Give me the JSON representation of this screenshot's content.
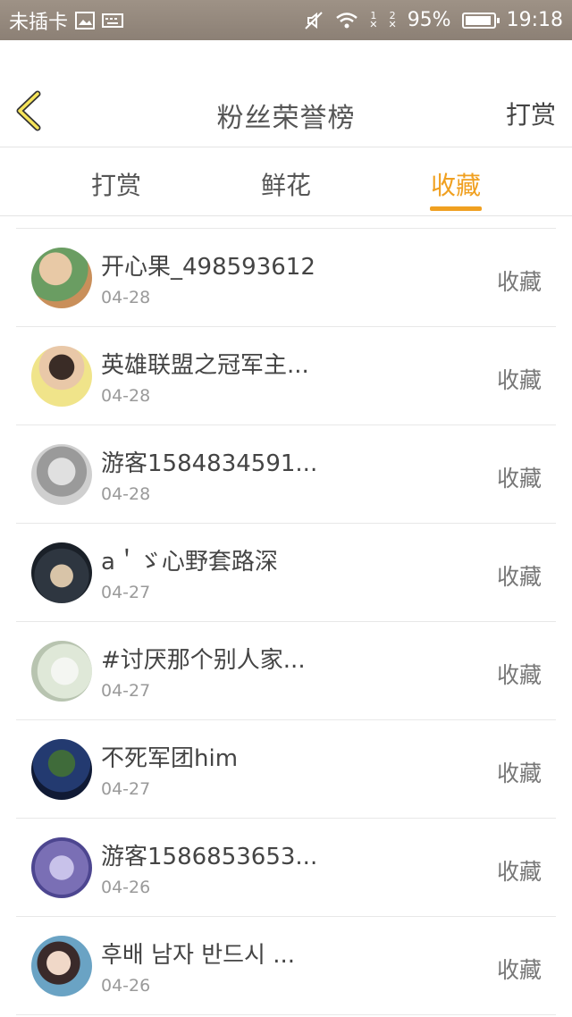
{
  "status_bar": {
    "carrier": "未插卡",
    "battery": "95%",
    "time": "19:18",
    "sim1": "1",
    "sim2": "2",
    "icons": [
      "image-icon",
      "keyboard-icon",
      "mute-icon",
      "wifi-icon",
      "signal1-icon",
      "signal2-icon",
      "battery-icon"
    ]
  },
  "header": {
    "title": "粉丝荣誉榜",
    "right_action": "打赏",
    "back_icon": "chevron-left-icon",
    "accent": "#f0a020"
  },
  "tabs": [
    {
      "label": "打赏",
      "active": false
    },
    {
      "label": "鲜花",
      "active": false
    },
    {
      "label": "收藏",
      "active": true
    }
  ],
  "list": [
    {
      "name": "开心果_498593612",
      "date": "04-28",
      "type": "收藏",
      "avatar_color": "#6a9d62"
    },
    {
      "name": "英雄联盟之冠军主...",
      "date": "04-28",
      "type": "收藏",
      "avatar_color": "#f0e48a"
    },
    {
      "name": "游客1584834591...",
      "date": "04-28",
      "type": "收藏",
      "avatar_color": "#b8b8b8"
    },
    {
      "name": "a＇ゞ心野套路深",
      "date": "04-27",
      "type": "收藏",
      "avatar_color": "#2e3640"
    },
    {
      "name": "#讨厌那个别人家...",
      "date": "04-27",
      "type": "收藏",
      "avatar_color": "#dfe8d8"
    },
    {
      "name": "不死军团him",
      "date": "04-27",
      "type": "收藏",
      "avatar_color": "#233a70"
    },
    {
      "name": "游客1586853653...",
      "date": "04-26",
      "type": "收藏",
      "avatar_color": "#7a6fb5"
    },
    {
      "name": "후배 남자 반드시 ...",
      "date": "04-26",
      "type": "收藏",
      "avatar_color": "#6aa3c4"
    }
  ]
}
